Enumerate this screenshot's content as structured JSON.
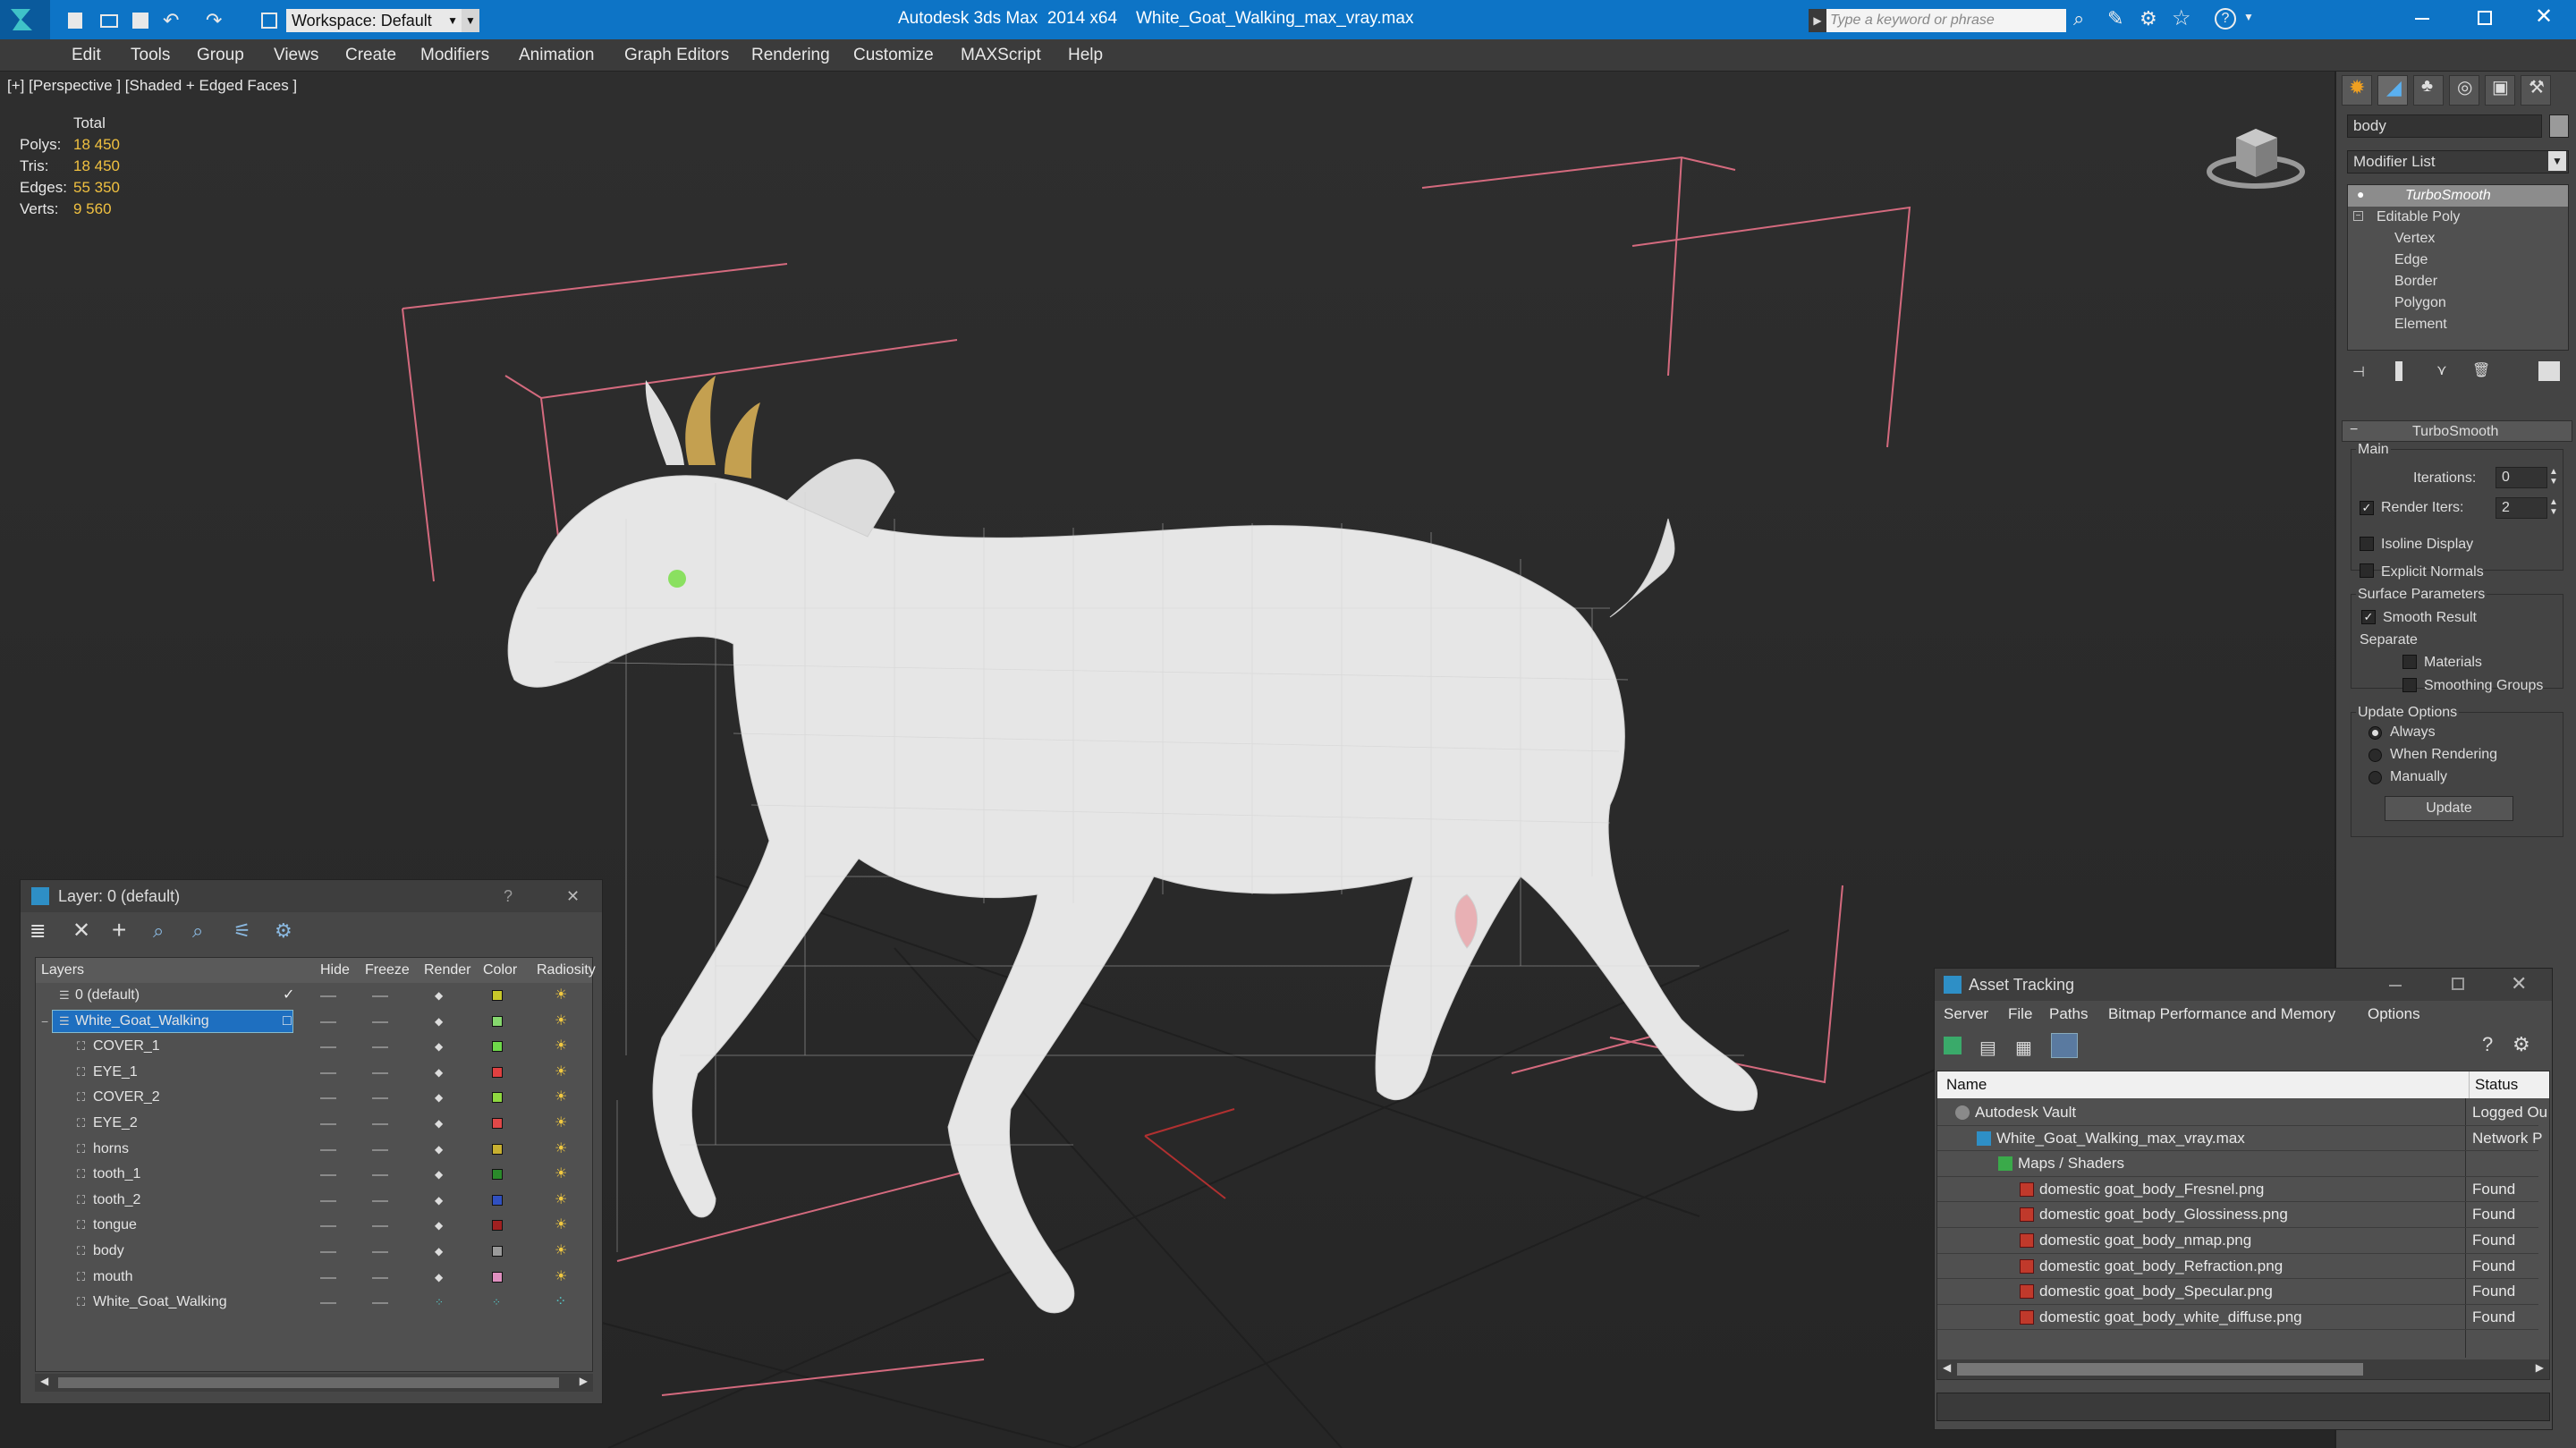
{
  "titlebar": {
    "app_title": "Autodesk 3ds Max  2014 x64",
    "file_title": "White_Goat_Walking_max_vray.max",
    "workspace_label": "Workspace: Default",
    "search_placeholder": "Type a keyword or phrase"
  },
  "menu": [
    "Edit",
    "Tools",
    "Group",
    "Views",
    "Create",
    "Modifiers",
    "Animation",
    "Graph Editors",
    "Rendering",
    "Customize",
    "MAXScript",
    "Help"
  ],
  "viewport": {
    "label": "[+] [Perspective ] [Shaded + Edged Faces ]",
    "stats_header": "Total",
    "stats": [
      {
        "label": "Polys:",
        "value": "18 450"
      },
      {
        "label": "Tris:",
        "value": "18 450"
      },
      {
        "label": "Edges:",
        "value": "55 350"
      },
      {
        "label": "Verts:",
        "value": "9 560"
      }
    ]
  },
  "command_panel": {
    "object_name": "body",
    "modifier_list_label": "Modifier List",
    "stack": [
      "TurboSmooth",
      "Editable Poly",
      "Vertex",
      "Edge",
      "Border",
      "Polygon",
      "Element"
    ],
    "rollout_title": "TurboSmooth",
    "main_group": "Main",
    "iterations_label": "Iterations:",
    "iterations_value": "0",
    "render_iters_label": "Render Iters:",
    "render_iters_value": "2",
    "isoline_label": "Isoline Display",
    "explicit_normals_label": "Explicit Normals",
    "surface_group": "Surface Parameters",
    "smooth_result_label": "Smooth Result",
    "separate_label": "Separate",
    "materials_label": "Materials",
    "smoothing_groups_label": "Smoothing Groups",
    "update_group": "Update Options",
    "always_label": "Always",
    "when_rendering_label": "When Rendering",
    "manually_label": "Manually",
    "update_button": "Update"
  },
  "layer_window": {
    "title": "Layer: 0 (default)",
    "help_glyph": "?",
    "close_glyph": "✕",
    "columns": [
      "Layers",
      "Hide",
      "Freeze",
      "Render",
      "Color",
      "Radiosity"
    ],
    "rows": [
      {
        "name": "0 (default)",
        "color": "#c8c82a",
        "level": 0
      },
      {
        "name": "White_Goat_Walking",
        "color": "#86d86e",
        "level": 0,
        "selected": true
      },
      {
        "name": "COVER_1",
        "color": "#6fd84a",
        "level": 1
      },
      {
        "name": "EYE_1",
        "color": "#e04040",
        "level": 1
      },
      {
        "name": "COVER_2",
        "color": "#8fd840",
        "level": 1
      },
      {
        "name": "EYE_2",
        "color": "#e04848",
        "level": 1
      },
      {
        "name": "horns",
        "color": "#c8b030",
        "level": 1
      },
      {
        "name": "tooth_1",
        "color": "#2a8a2a",
        "level": 1
      },
      {
        "name": "tooth_2",
        "color": "#3050c0",
        "level": 1
      },
      {
        "name": "tongue",
        "color": "#a02020",
        "level": 1
      },
      {
        "name": "body",
        "color": "#9a9a9a",
        "level": 1
      },
      {
        "name": "mouth",
        "color": "#e090c0",
        "level": 1
      },
      {
        "name": "White_Goat_Walking",
        "color": "",
        "level": 1
      }
    ]
  },
  "asset_window": {
    "title": "Asset Tracking",
    "menu": [
      "Server",
      "File",
      "Paths",
      "Bitmap Performance and Memory",
      "Options"
    ],
    "columns": [
      "Name",
      "Status"
    ],
    "rows": [
      {
        "name": "Autodesk Vault",
        "status": "Logged Ou",
        "level": 0
      },
      {
        "name": "White_Goat_Walking_max_vray.max",
        "status": "Network P",
        "level": 1
      },
      {
        "name": "Maps / Shaders",
        "status": "",
        "level": 2
      },
      {
        "name": "domestic goat_body_Fresnel.png",
        "status": "Found",
        "level": 3
      },
      {
        "name": "domestic goat_body_Glossiness.png",
        "status": "Found",
        "level": 3
      },
      {
        "name": "domestic goat_body_nmap.png",
        "status": "Found",
        "level": 3
      },
      {
        "name": "domestic goat_body_Refraction.png",
        "status": "Found",
        "level": 3
      },
      {
        "name": "domestic goat_body_Specular.png",
        "status": "Found",
        "level": 3
      },
      {
        "name": "domestic goat_body_white_diffuse.png",
        "status": "Found",
        "level": 3
      }
    ]
  }
}
